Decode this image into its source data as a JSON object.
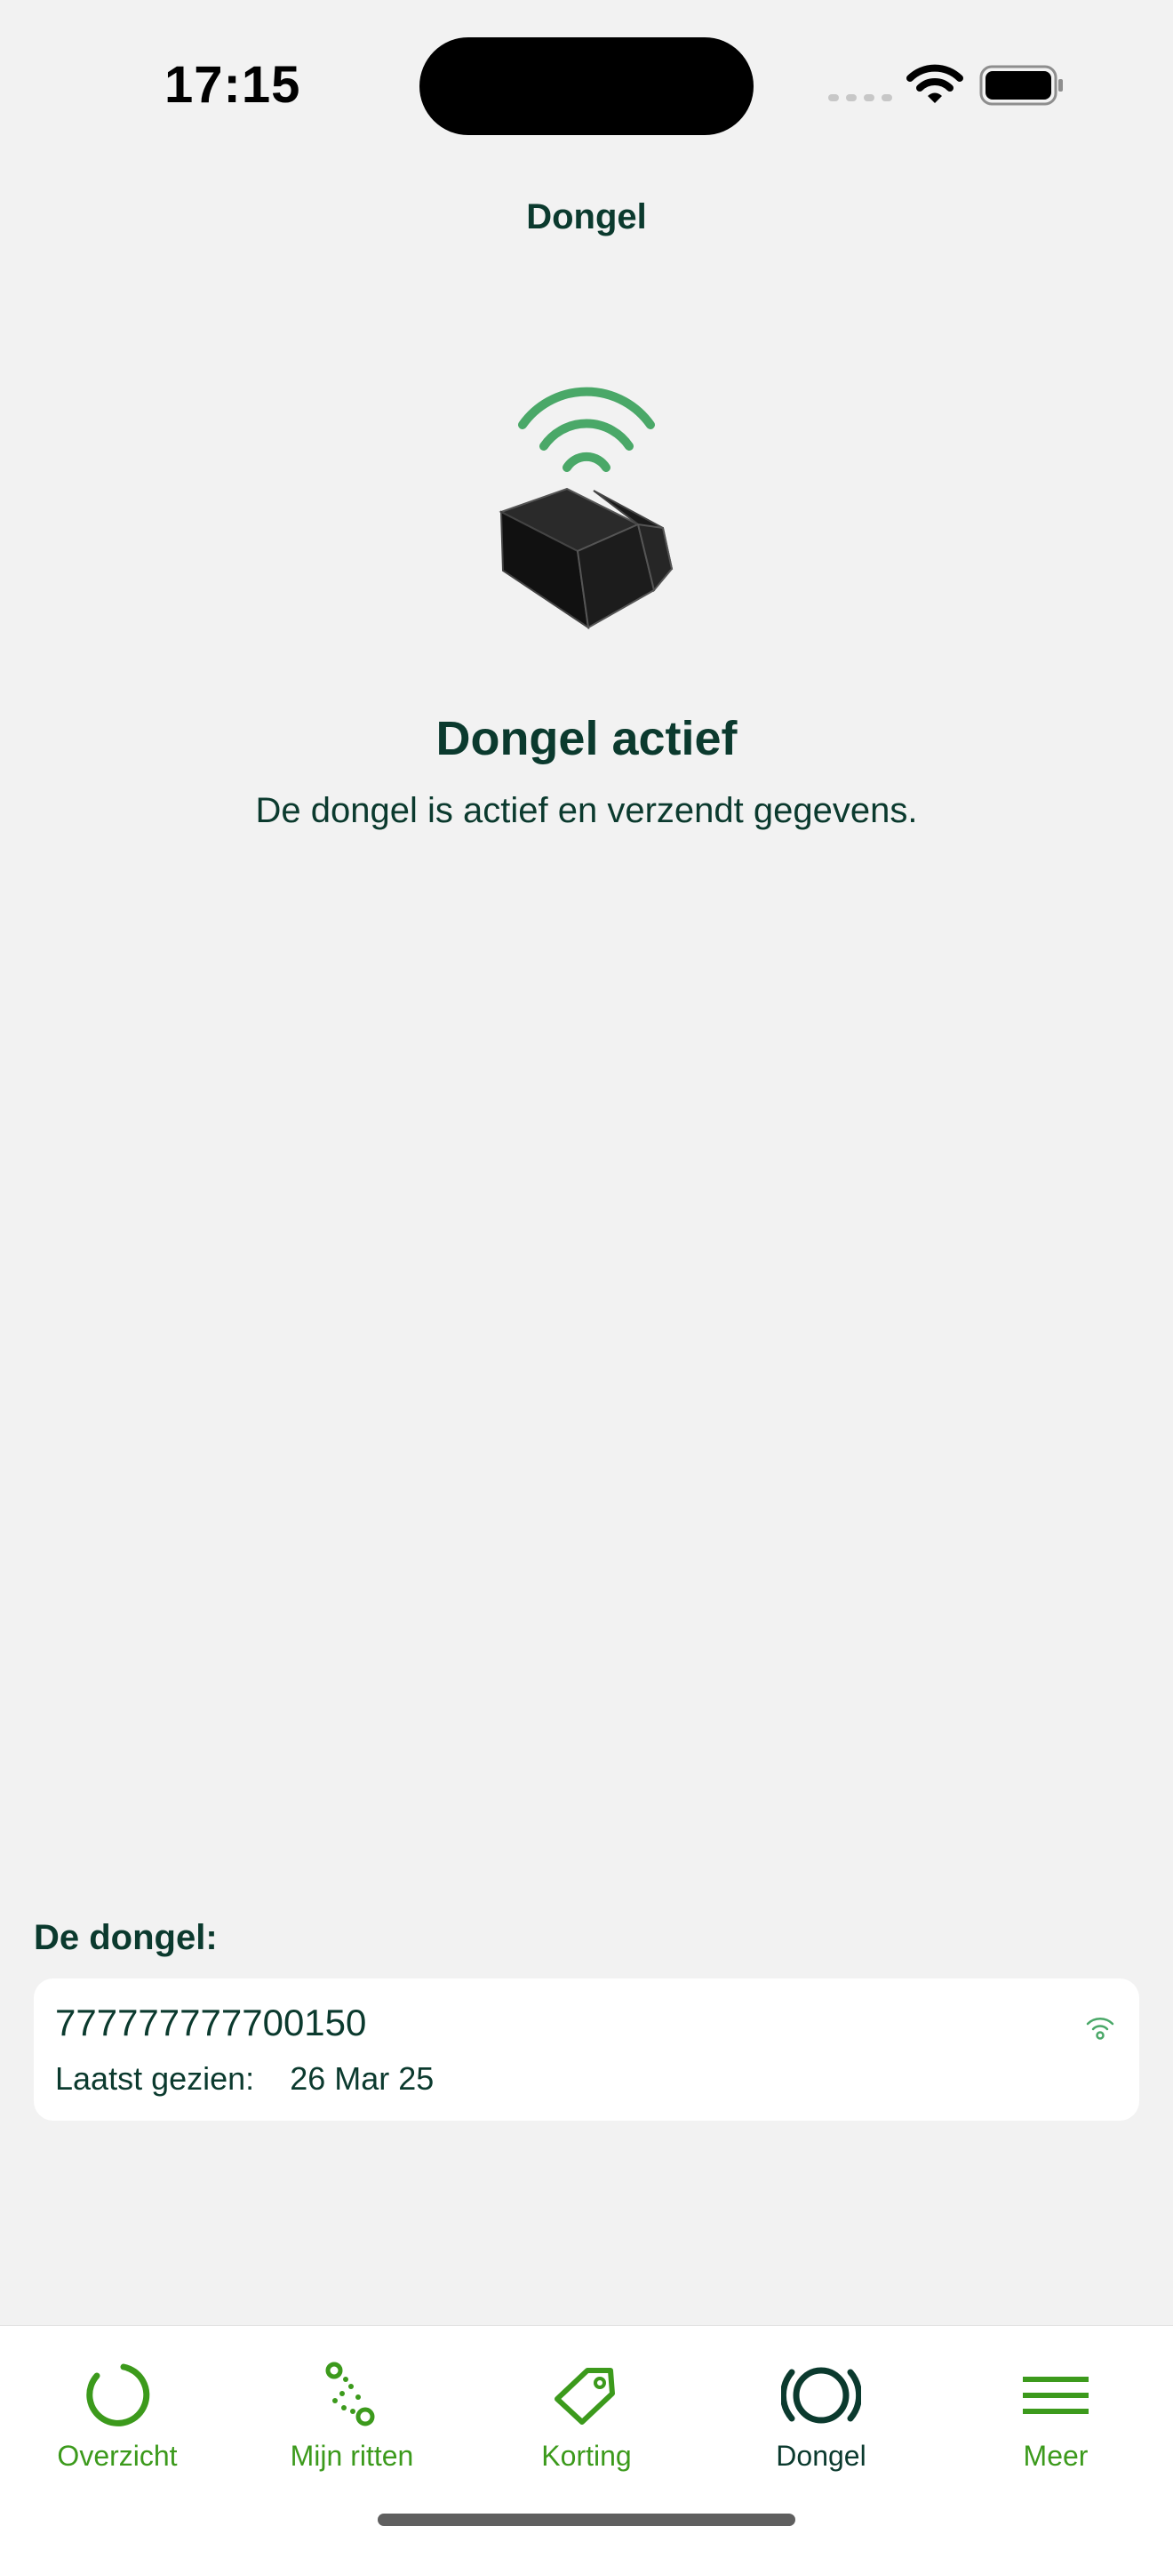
{
  "status_bar": {
    "time": "17:15"
  },
  "nav": {
    "title": "Dongel"
  },
  "hero": {
    "title": "Dongel actief",
    "subtitle": "De dongel is actief en verzendt gegevens."
  },
  "dongle_section": {
    "label": "De dongel:",
    "device": {
      "id": "777777777700150",
      "last_seen_label": "Laatst gezien:",
      "last_seen_value": "26 Mar 25"
    }
  },
  "tab_bar": {
    "tabs": [
      {
        "label": "Overzicht",
        "icon": "circle-progress-icon",
        "active": false
      },
      {
        "label": "Mijn ritten",
        "icon": "route-icon",
        "active": false
      },
      {
        "label": "Korting",
        "icon": "tag-icon",
        "active": false
      },
      {
        "label": "Dongel",
        "icon": "dongle-signal-icon",
        "active": true
      },
      {
        "label": "Meer",
        "icon": "menu-icon",
        "active": false
      }
    ]
  },
  "colors": {
    "accent_green": "#3c9a1c",
    "wifi_green": "#4aa868",
    "dark_text": "#0b3a2e",
    "background": "#f2f2f2",
    "card": "#ffffff"
  }
}
